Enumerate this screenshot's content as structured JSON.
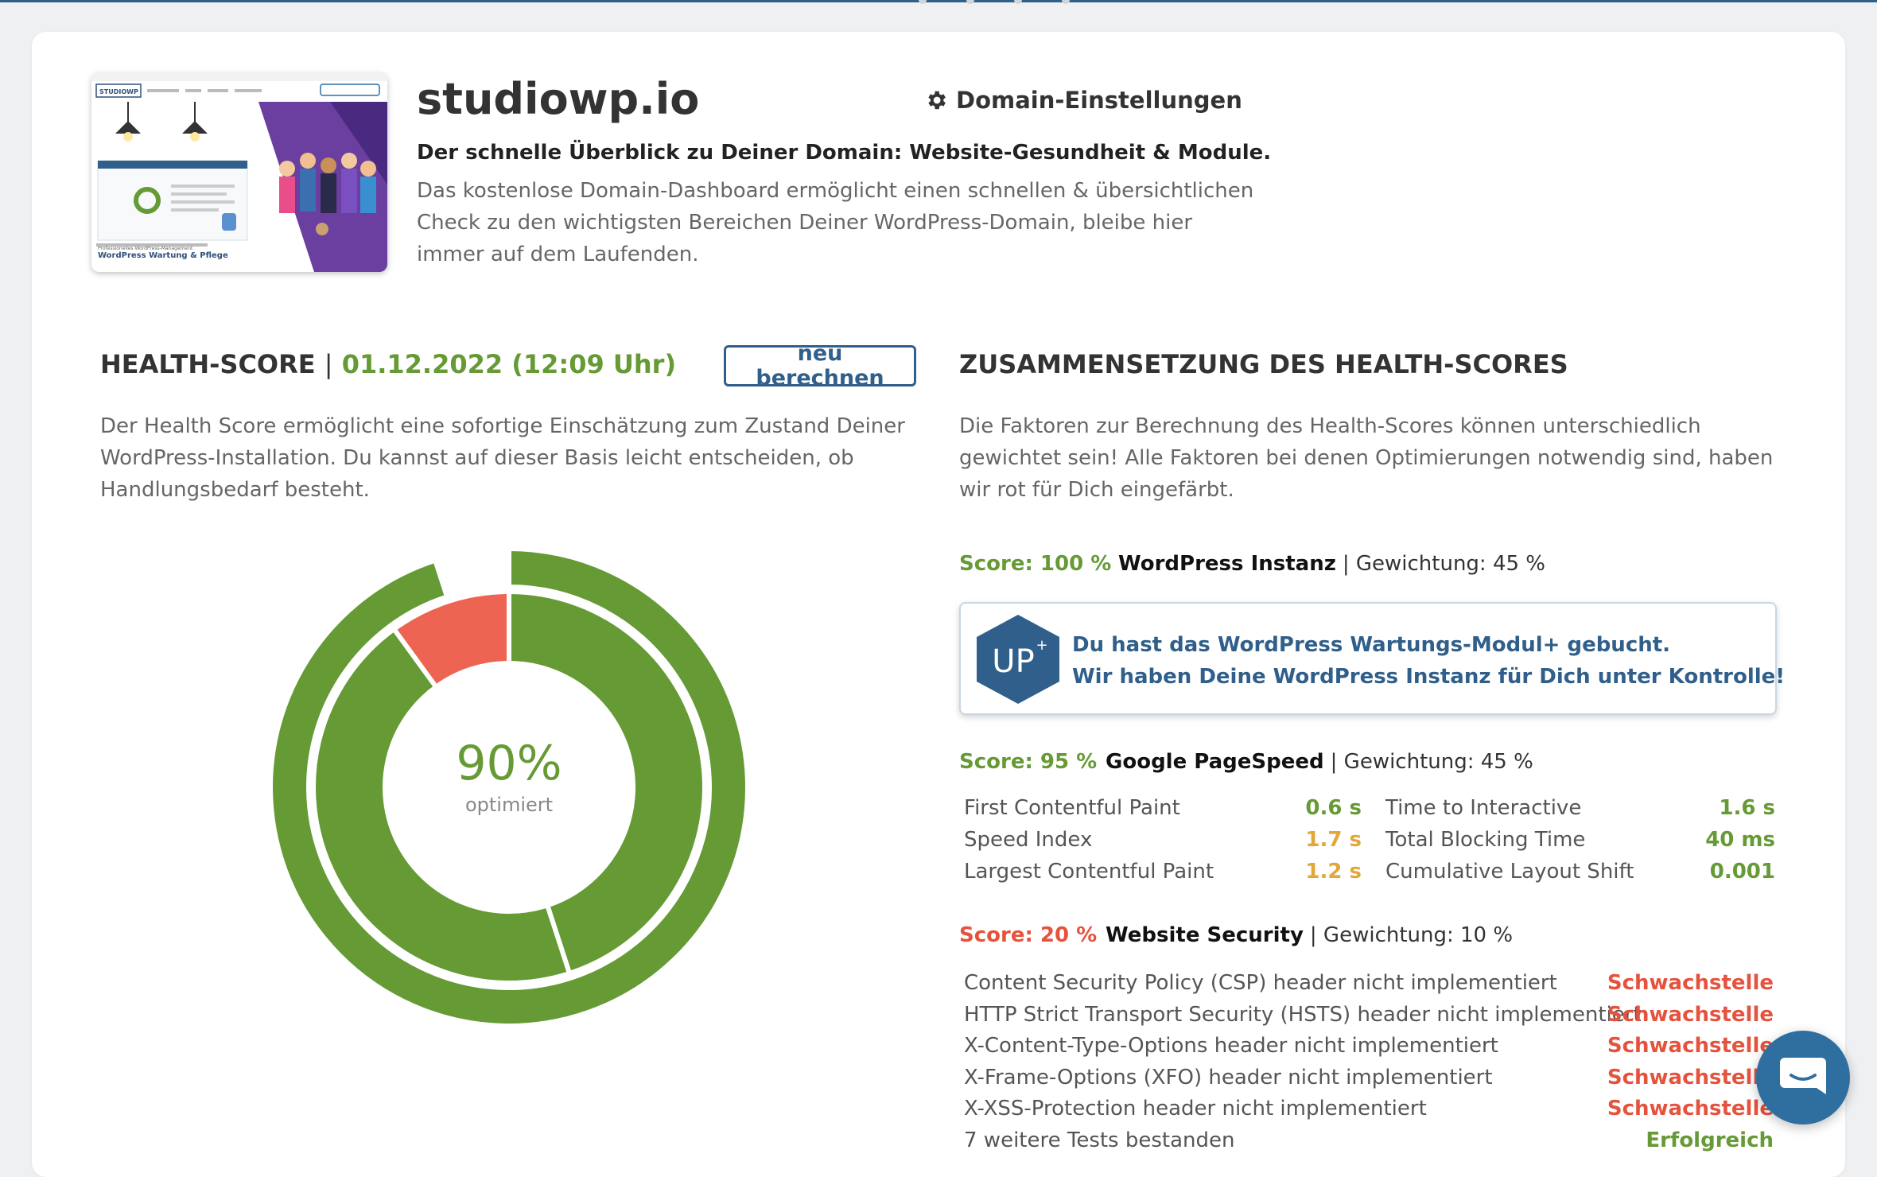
{
  "header": {
    "domain": "studiowp.io",
    "settings_label": "Domain-Einstellungen",
    "subtitle": "Der schnelle Überblick zu Deiner Domain: Website-Gesundheit & Module.",
    "description": "Das kostenlose Domain-Dashboard ermöglicht einen schnellen & übersichtlichen Check zu den wichtigsten Bereichen Deiner WordPress-Domain, bleibe hier immer auf dem Laufenden.",
    "thumbnail": {
      "logo": "STUDIOWP",
      "caption_small": "Professionelles WordPress-Management",
      "caption": "WordPress Wartung & Pflege"
    }
  },
  "health": {
    "title": "HEALTH-SCORE",
    "separator": "|",
    "date": "01.12.2022 (12:09 Uhr)",
    "recalc_label": "neu berechnen",
    "description": "Der Health Score ermöglicht eine sofortige Einschätzung zum Zustand Deiner WordPress-Installation. Du kannst auf dieser Basis leicht entscheiden, ob Handlungsbedarf besteht.",
    "percent_label": "90%",
    "status_label": "optimiert",
    "optimized_fraction": 0.9,
    "outer_fraction": 0.95,
    "colors": {
      "good": "#659a34",
      "bad": "#ee6452"
    }
  },
  "composition": {
    "title": "ZUSAMMENSETZUNG DES HEALTH-SCORES",
    "description": "Die Faktoren zur Berechnung des Health-Scores können unterschiedlich gewichtet sein! Alle Faktoren bei denen Optimierungen notwendig sind, haben wir rot für Dich eingefärbt.",
    "sections": [
      {
        "score": "Score: 100 %",
        "name": "WordPress Instanz",
        "weight": "| Gewichtung: 45 %"
      },
      {
        "score": "Score: 95 %",
        "name": "Google PageSpeed",
        "weight": "| Gewichtung: 45 %"
      },
      {
        "score": "Score: 20 %",
        "name": "Website Security",
        "weight": "| Gewichtung: 10 %"
      }
    ],
    "module_box": {
      "badge": "UP",
      "badge_sup": "+",
      "line1": "Du hast das WordPress Wartungs-Modul+ gebucht.",
      "line2": "Wir haben Deine WordPress Instanz für Dich unter Kontrolle!"
    },
    "pagespeed": [
      {
        "label": "First Contentful Paint",
        "value": "0.6 s",
        "label2": "Time to Interactive",
        "value2": "1.6 s"
      },
      {
        "label": "Speed Index",
        "value": "1.7 s",
        "label2": "Total Blocking Time",
        "value2": "40 ms"
      },
      {
        "label": "Largest Contentful Paint",
        "value": "1.2 s",
        "label2": "Cumulative Layout Shift",
        "value2": "0.001"
      }
    ],
    "security": [
      {
        "label": "Content Security Policy (CSP) header nicht implementiert",
        "value": "Schwachstelle"
      },
      {
        "label": "HTTP Strict Transport Security (HSTS) header nicht implementiert",
        "value": "Schwachstelle"
      },
      {
        "label": "X-Content-Type-Options header nicht implementiert",
        "value": "Schwachstelle"
      },
      {
        "label": "X-Frame-Options (XFO) header nicht implementiert",
        "value": "Schwachstelle"
      },
      {
        "label": "X-XSS-Protection header nicht implementiert",
        "value": "Schwachstelle"
      },
      {
        "label": "7 weitere Tests bestanden",
        "value": "Erfolgreich"
      }
    ]
  }
}
